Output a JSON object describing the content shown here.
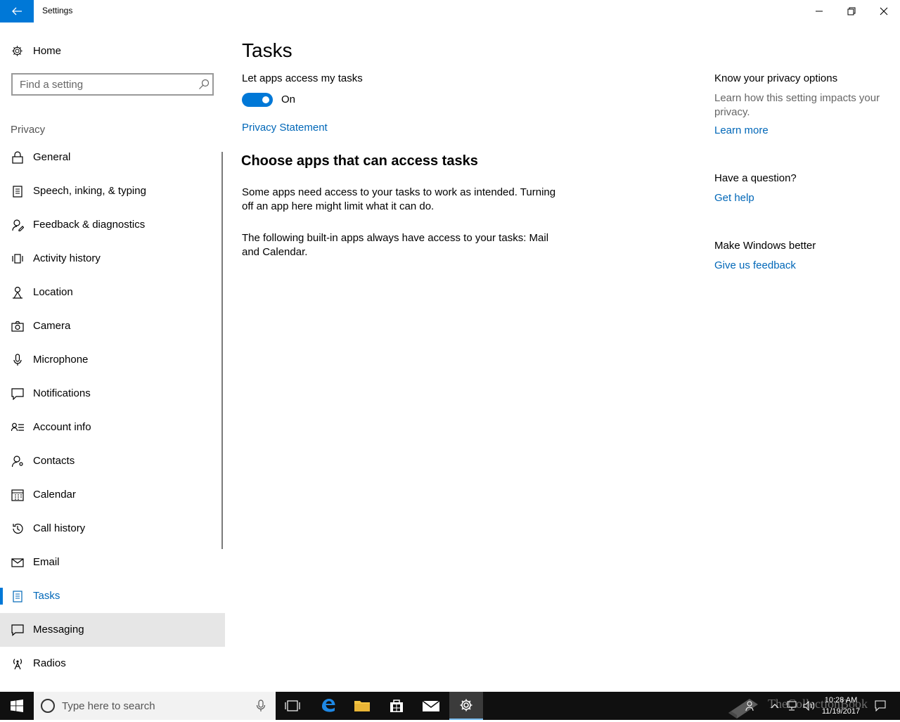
{
  "window": {
    "title": "Settings"
  },
  "sidebar": {
    "home_label": "Home",
    "search_placeholder": "Find a setting",
    "section_label": "Privacy",
    "items": [
      {
        "label": "General",
        "icon": "lock-icon"
      },
      {
        "label": "Speech, inking, & typing",
        "icon": "clipboard-icon"
      },
      {
        "label": "Feedback & diagnostics",
        "icon": "feedback-icon"
      },
      {
        "label": "Activity history",
        "icon": "activity-icon"
      },
      {
        "label": "Location",
        "icon": "location-icon"
      },
      {
        "label": "Camera",
        "icon": "camera-icon"
      },
      {
        "label": "Microphone",
        "icon": "microphone-icon"
      },
      {
        "label": "Notifications",
        "icon": "notifications-icon"
      },
      {
        "label": "Account info",
        "icon": "account-info-icon"
      },
      {
        "label": "Contacts",
        "icon": "contacts-icon"
      },
      {
        "label": "Calendar",
        "icon": "calendar-icon"
      },
      {
        "label": "Call history",
        "icon": "call-history-icon"
      },
      {
        "label": "Email",
        "icon": "email-icon"
      },
      {
        "label": "Tasks",
        "icon": "tasks-icon",
        "selected": true
      },
      {
        "label": "Messaging",
        "icon": "messaging-icon",
        "hover": true
      },
      {
        "label": "Radios",
        "icon": "radios-icon"
      }
    ]
  },
  "main": {
    "title": "Tasks",
    "toggle_label": "Let apps access my tasks",
    "toggle_state": "On",
    "toggle_on": true,
    "privacy_link": "Privacy Statement",
    "sub_heading": "Choose apps that can access tasks",
    "para1": "Some apps need access to your tasks to work as intended. Turning off an app here might limit what it can do.",
    "para2": "The following built-in apps always have access to your tasks: Mail and Calendar."
  },
  "aside": {
    "privacy_heading": "Know your privacy options",
    "privacy_text": "Learn how this setting impacts your privacy.",
    "learn_more": "Learn more",
    "question_heading": "Have a question?",
    "get_help": "Get help",
    "better_heading": "Make Windows better",
    "feedback_link": "Give us feedback"
  },
  "taskbar": {
    "search_placeholder": "Type here to search",
    "time": "10:28 AM",
    "date": "11/19/2017",
    "watermark": "TheCollectionBook"
  },
  "colors": {
    "accent": "#0078d7",
    "link": "#0067b8",
    "taskbar": "#101010"
  }
}
